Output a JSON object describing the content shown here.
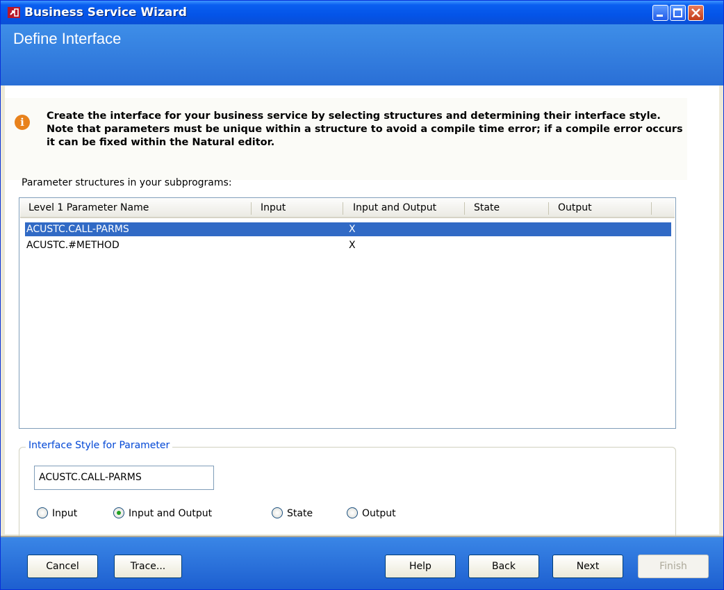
{
  "window": {
    "title": "Business Service Wizard"
  },
  "header": {
    "title": "Define Interface"
  },
  "info": {
    "text": "Create the interface for your business service by selecting structures and determining their interface style.  Note that parameters must be unique within a structure to avoid a compile time error; if a compile error occurs it can be fixed within the Natural editor."
  },
  "list": {
    "label": "Parameter structures in your subprograms:",
    "columns": [
      "Level 1 Parameter Name",
      "Input",
      "Input and Output",
      "State",
      "Output"
    ],
    "rows": [
      {
        "name": "ACUSTC.CALL-PARMS",
        "input": "",
        "input_output": "X",
        "state": "",
        "output": "",
        "selected": true
      },
      {
        "name": "ACUSTC.#METHOD",
        "input": "",
        "input_output": "X",
        "state": "",
        "output": "",
        "selected": false
      }
    ]
  },
  "interface_style": {
    "title": "Interface Style for Parameter",
    "parameter": "ACUSTC.CALL-PARMS",
    "options": [
      "Input",
      "Input and Output",
      "State",
      "Output"
    ],
    "selected": "Input and Output"
  },
  "buttons": {
    "cancel": "Cancel",
    "trace": "Trace...",
    "help": "Help",
    "back": "Back",
    "next": "Next",
    "finish": "Finish"
  },
  "colors": {
    "selection": "#316ac5",
    "titlebar": "#0454e8",
    "group_title": "#0046d5"
  },
  "icons": {
    "app": "wizard-app-icon",
    "info": "info-icon"
  }
}
